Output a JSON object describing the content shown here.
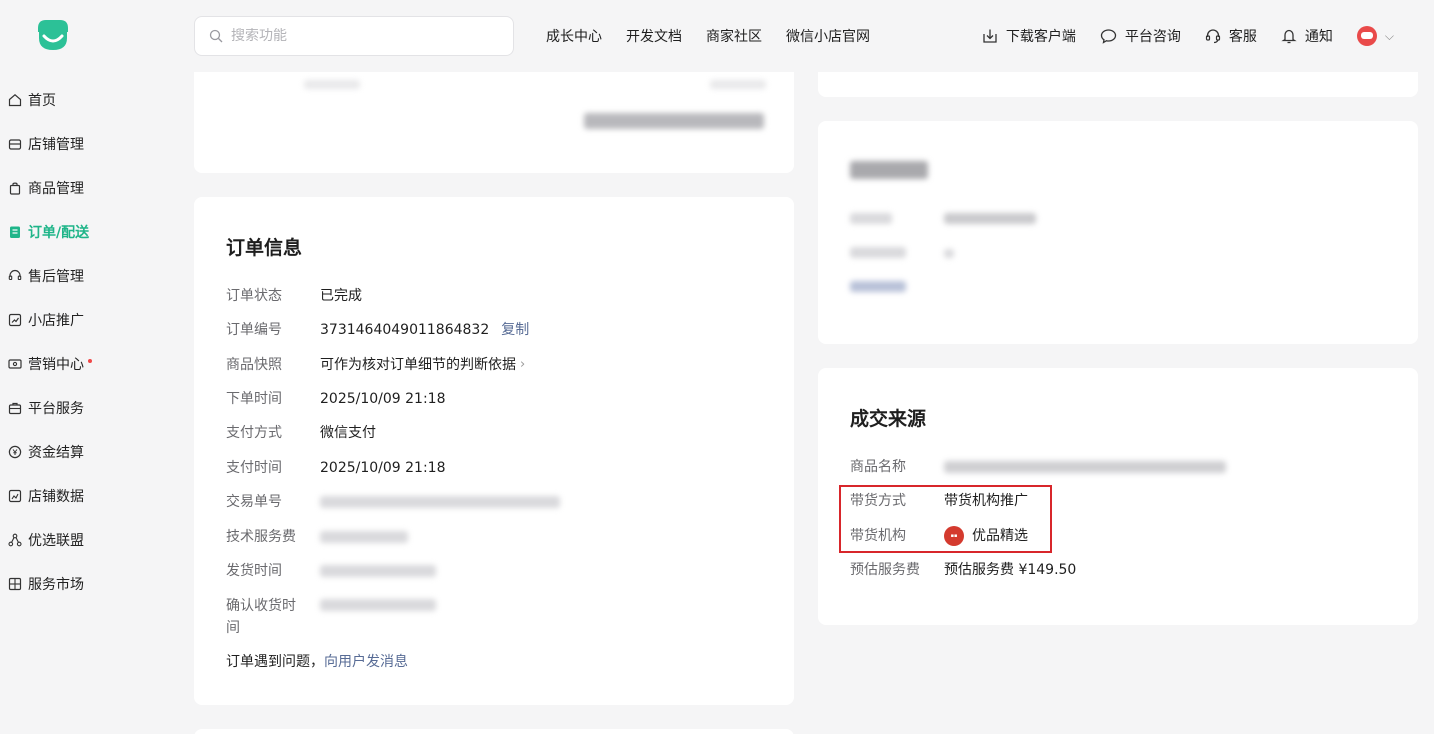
{
  "search": {
    "placeholder": "搜索功能"
  },
  "topnav": [
    "成长中心",
    "开发文档",
    "商家社区",
    "微信小店官网"
  ],
  "topright": {
    "download": "下载客户端",
    "consult": "平台咨询",
    "service": "客服",
    "notify": "通知"
  },
  "sidebar": {
    "items": [
      {
        "label": "首页",
        "icon": "home-icon"
      },
      {
        "label": "店铺管理",
        "icon": "store-icon"
      },
      {
        "label": "商品管理",
        "icon": "bag-icon"
      },
      {
        "label": "订单/配送",
        "icon": "order-icon"
      },
      {
        "label": "售后管理",
        "icon": "headset-icon"
      },
      {
        "label": "小店推广",
        "icon": "chart-icon"
      },
      {
        "label": "营销中心",
        "icon": "ticket-icon"
      },
      {
        "label": "平台服务",
        "icon": "briefcase-icon"
      },
      {
        "label": "资金结算",
        "icon": "yen-icon"
      },
      {
        "label": "店铺数据",
        "icon": "data-icon"
      },
      {
        "label": "优选联盟",
        "icon": "network-icon"
      },
      {
        "label": "服务市场",
        "icon": "grid-icon"
      }
    ]
  },
  "order_info": {
    "title": "订单信息",
    "rows": [
      {
        "label": "订单状态",
        "value": "已完成"
      },
      {
        "label": "订单编号",
        "value": "3731464049011864832",
        "action": "复制"
      },
      {
        "label": "商品快照",
        "value": "可作为核对订单细节的判断依据"
      },
      {
        "label": "下单时间",
        "value": "2025/10/09 21:18"
      },
      {
        "label": "支付方式",
        "value": "微信支付"
      },
      {
        "label": "支付时间",
        "value": "2025/10/09 21:18"
      },
      {
        "label": "交易单号"
      },
      {
        "label": "技术服务费"
      },
      {
        "label": "发货时间"
      },
      {
        "label": "确认收货时间"
      }
    ],
    "footer_text": "订单遇到问题，",
    "footer_link": "向用户发消息"
  },
  "deal_source": {
    "title": "成交来源",
    "product_name_label": "商品名称",
    "method_label": "带货方式",
    "method_value": "带货机构推广",
    "org_label": "带货机构",
    "org_value": "优品精选",
    "fee_label": "预估服务费",
    "fee_value": "预估服务费 ¥149.50"
  }
}
